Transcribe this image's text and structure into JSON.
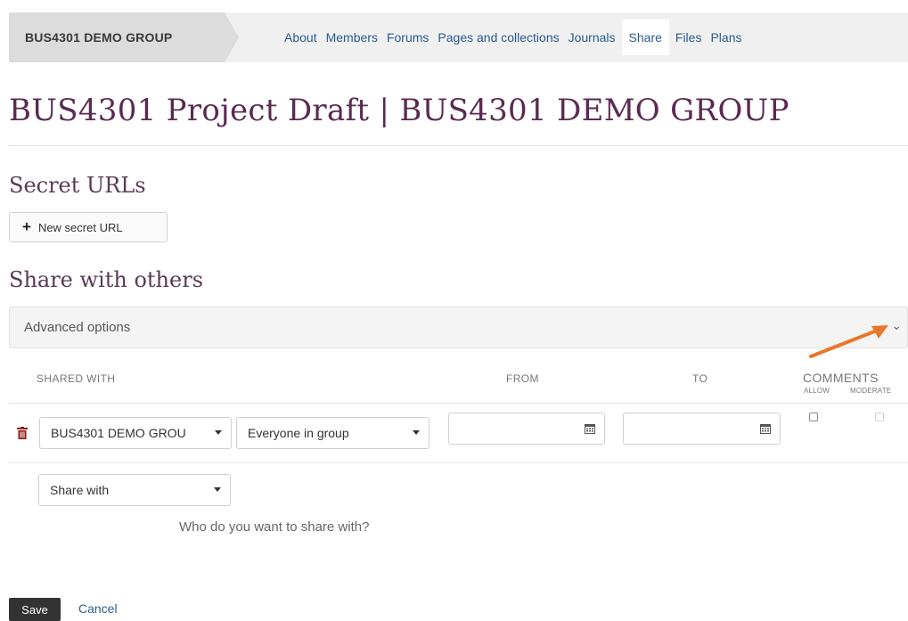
{
  "nav": {
    "group_name": "BUS4301 DEMO GROUP",
    "links": [
      "About",
      "Members",
      "Forums",
      "Pages and collections",
      "Journals",
      "Share",
      "Files",
      "Plans"
    ],
    "active": "Share"
  },
  "page": {
    "title": "BUS4301 Project Draft | BUS4301 DEMO GROUP"
  },
  "secret_urls": {
    "heading": "Secret URLs",
    "new_button": "New secret URL"
  },
  "share": {
    "heading": "Share with others",
    "advanced_options": "Advanced options",
    "columns": {
      "shared_with": "SHARED WITH",
      "from": "FROM",
      "to": "TO",
      "comments": "COMMENTS",
      "allow": "ALLOW",
      "moderate": "MODERATE"
    },
    "row": {
      "group_select": "BUS4301 DEMO GROU",
      "role_select": "Everyone in group",
      "from_value": "",
      "to_value": ""
    },
    "new_select": "Share with",
    "hint": "Who do you want to share with?"
  },
  "actions": {
    "save": "Save",
    "cancel": "Cancel"
  },
  "colors": {
    "accent_link": "#2a5b8f",
    "title": "#5b2a52",
    "arrow": "#e8782a",
    "trash": "#8b1d12"
  }
}
